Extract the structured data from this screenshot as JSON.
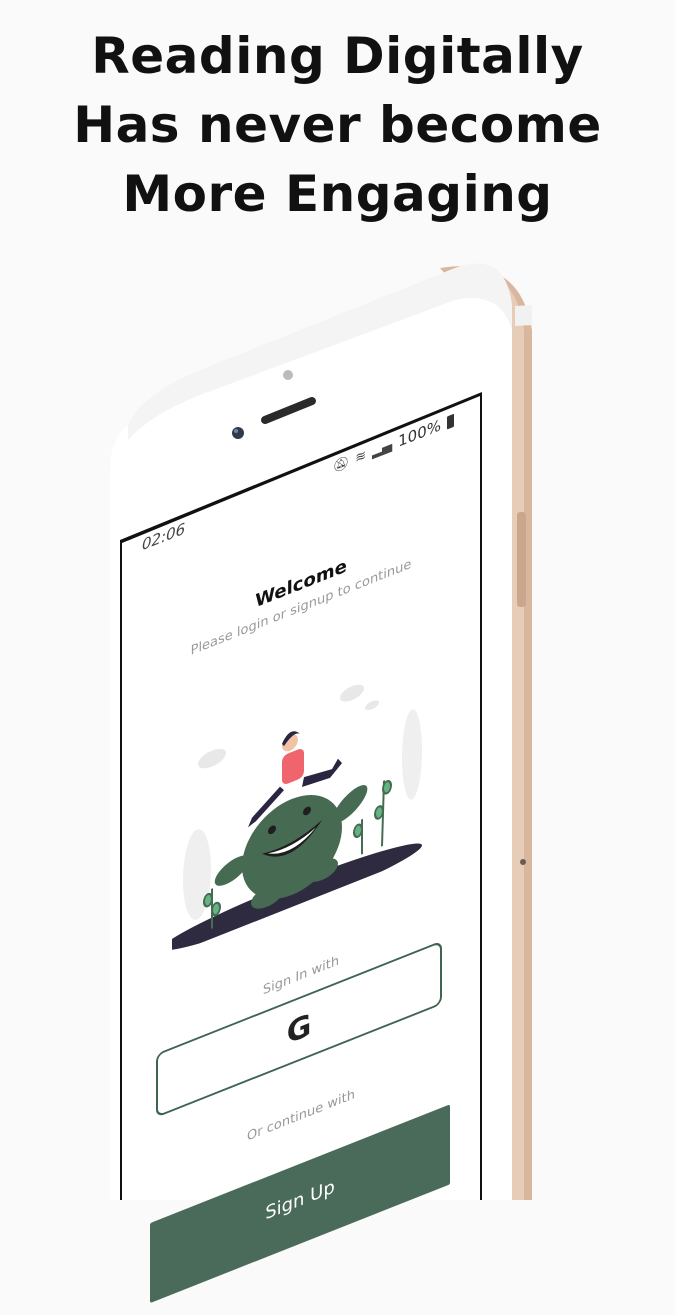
{
  "headline": {
    "line1": "Reading Digitally",
    "line2": "Has never become",
    "line3": "More Engaging"
  },
  "status_bar": {
    "time": "02:06",
    "battery": "100%",
    "mute_icon": "mute-icon",
    "wifi_icon": "wifi-icon",
    "signal_icon": "signal-icon",
    "battery_icon": "battery-icon"
  },
  "screen": {
    "title": "Welcome",
    "subtitle": "Please login or signup to continue",
    "signin_label": "Sign In with",
    "google_button_glyph": "G",
    "or_label": "Or continue with",
    "signup_label": "Sign Up"
  },
  "colors": {
    "accent_green": "#4b6b5a",
    "phone_frame_gold": "#d9b9a0",
    "headline_text": "#111111"
  }
}
